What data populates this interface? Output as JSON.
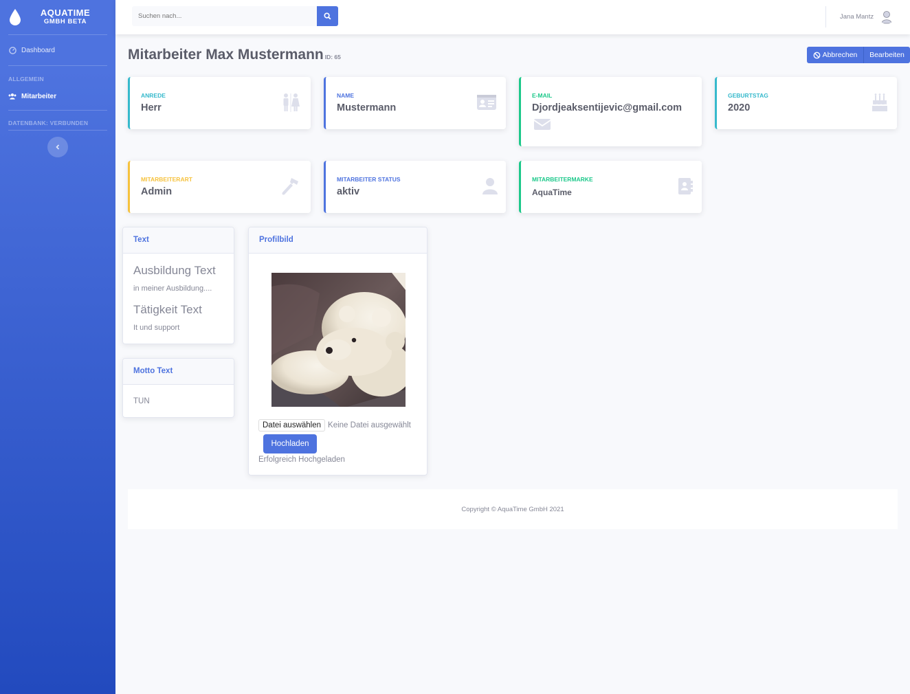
{
  "brand": {
    "line1": "AQUATIME",
    "line2": "GMBH BETA"
  },
  "sidebar": {
    "items": [
      {
        "label": "Dashboard",
        "icon": "dashboard-icon"
      },
      {
        "label": "Mitarbeiter",
        "icon": "users-icon"
      }
    ],
    "heading_general": "ALLGEMEIN",
    "heading_db": "DATENBANK: VERBUNDEN"
  },
  "search": {
    "placeholder": "Suchen nach..."
  },
  "user": {
    "name": "Jana Mantz"
  },
  "page": {
    "title": "Mitarbeiter Max Mustermann",
    "id_label": "ID: 65"
  },
  "actions": {
    "cancel": "Abbrechen",
    "edit": "Bearbeiten"
  },
  "cards": {
    "anrede": {
      "label": "ANREDE",
      "value": "Herr",
      "icon": "restroom-icon"
    },
    "name": {
      "label": "NAME",
      "value": "Mustermann",
      "icon": "id-card-icon"
    },
    "email": {
      "label": "E-MAIL",
      "value": "Djordjeaksentijevic@gmail.com",
      "icon": "envelope-icon"
    },
    "birthday": {
      "label": "GEBURTSTAG",
      "value": "2020",
      "icon": "birthday-cake-icon"
    },
    "type": {
      "label": "MITARBEITERART",
      "value": "Admin",
      "icon": "hammer-icon"
    },
    "status": {
      "label": "MITARBEITER STATUS",
      "value": "aktiv",
      "icon": "user-icon"
    },
    "brand": {
      "label": "MITARBEITERMARKE",
      "value": "AquaTime",
      "icon": "address-book-icon"
    }
  },
  "text_panel": {
    "title": "Text",
    "training_heading": "Ausbildung Text",
    "training_text": "in meiner Ausbildung....",
    "activity_heading": "Tätigkeit Text",
    "activity_text": "It und support"
  },
  "motto_panel": {
    "title": "Motto Text",
    "text": "TUN"
  },
  "profile_panel": {
    "title": "Profilbild",
    "file_button": "Datei auswählen",
    "file_status": "Keine Datei ausgewählt",
    "upload_button": "Hochladen",
    "message": "Erfolgreich Hochgeladen"
  },
  "footer": {
    "text": "Copyright © AquaTime GmbH 2021"
  },
  "colors": {
    "primary": "#4e73df",
    "info": "#36b9cc",
    "success": "#1cc88a",
    "warning": "#f6c23e"
  }
}
